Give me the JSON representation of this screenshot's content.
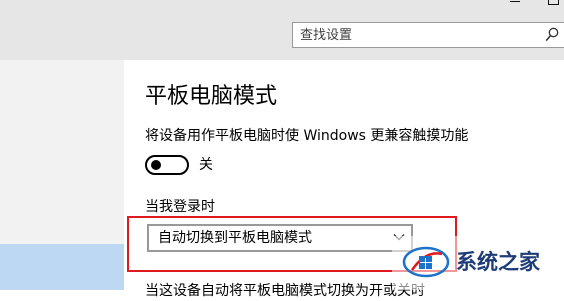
{
  "search": {
    "placeholder": "查找设置"
  },
  "main": {
    "title": "平板电脑模式",
    "description": "将设备用作平板电脑时使 Windows 更兼容触摸功能",
    "toggle": {
      "state": "off",
      "label": "关"
    },
    "signin": {
      "label": "当我登录时",
      "selected": "自动切换到平板电脑模式"
    },
    "next_line": "当这设备自动将平板电脑模式切换为开或关时"
  },
  "watermark": {
    "text": "系统之家"
  },
  "colors": {
    "top_bar": "#e6e6e6",
    "left_nav": "#f2f2f2",
    "nav_selected": "#bcd8f2",
    "highlight": "#e0191e",
    "watermark_text": "#1e3c78"
  },
  "icons": {
    "search": "search-icon",
    "dropdown": "chevron-down-icon",
    "watermark_logo": "watermark-logo-icon"
  }
}
